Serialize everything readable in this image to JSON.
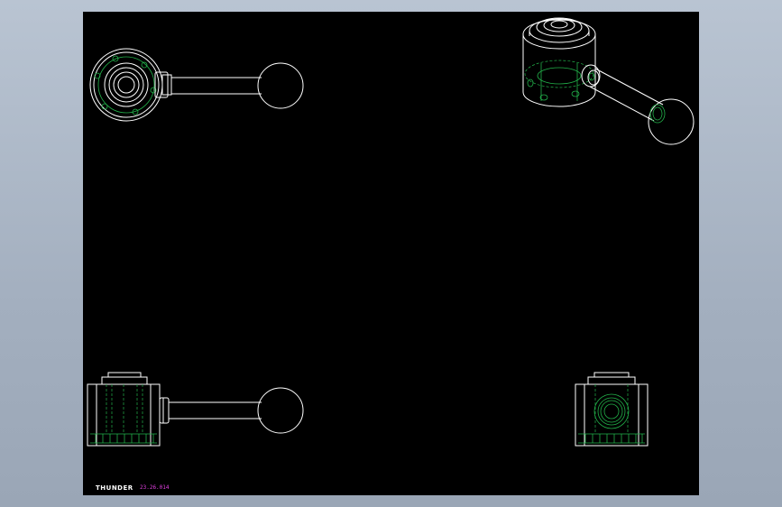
{
  "colors": {
    "background": "#aab5c4",
    "sheet": "#000000",
    "edge": "#ffffff",
    "hidden": "#22b24a",
    "code_text": "#e040e0"
  },
  "views": [
    {
      "name": "top-view"
    },
    {
      "name": "isometric-view"
    },
    {
      "name": "front-view"
    },
    {
      "name": "side-view"
    }
  ],
  "footer": {
    "logo": "THUNDER",
    "code": "23.26.014"
  }
}
